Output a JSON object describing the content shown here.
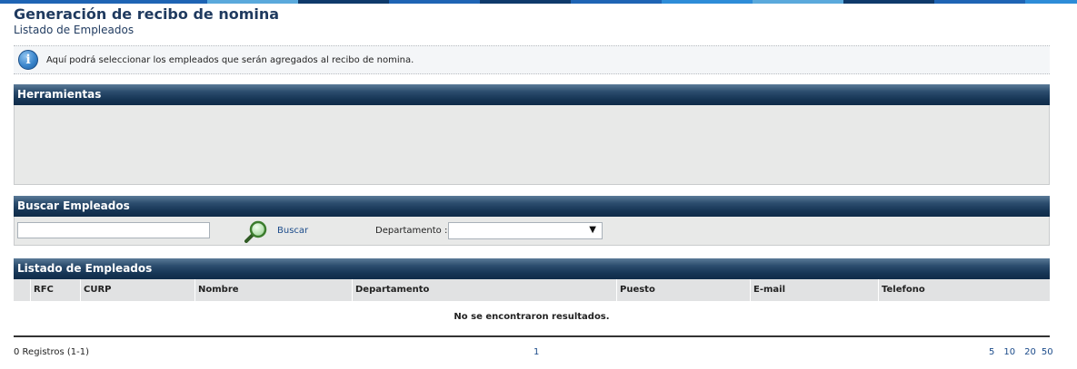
{
  "header": {
    "title": "Generación de recibo de nomina",
    "subtitle": "Listado de Empleados"
  },
  "info": {
    "icon": "info-icon",
    "message": "Aquí podrá seleccionar los empleados que serán agregados al recibo de nomina."
  },
  "tools_panel": {
    "title": "Herramientas"
  },
  "search_panel": {
    "title": "Buscar Empleados",
    "input_value": "",
    "search_label": "Buscar",
    "department_label": "Departamento :",
    "department_value": ""
  },
  "list_panel": {
    "title": "Listado de Empleados",
    "columns": [
      "RFC",
      "CURP",
      "Nombre",
      "Departamento",
      "Puesto",
      "E-mail",
      "Telefono"
    ],
    "empty_message": "No se encontraron resultados."
  },
  "footer": {
    "records": "0 Registros (1-1)",
    "current_page": "1",
    "page_sizes": [
      "5",
      "10",
      "20",
      "50"
    ]
  },
  "colors": {
    "header_dark": "#173656",
    "title_blue": "#1f3a5f",
    "link_blue": "#1b4b8a",
    "panel_bg": "#e8e9e8"
  }
}
